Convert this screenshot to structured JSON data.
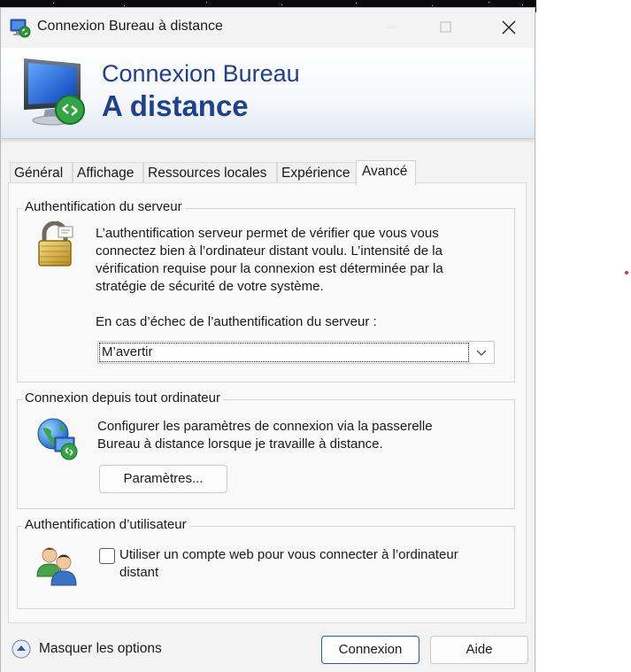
{
  "window": {
    "title": "Connexion Bureau à distance",
    "icons": [
      "remote-desktop-icon",
      "minimize-icon",
      "maximize-icon",
      "close-icon"
    ]
  },
  "banner": {
    "line1": "Connexion Bureau",
    "line2": "A distance",
    "icon": "remote-desktop-monitor-icon"
  },
  "tabs": [
    {
      "label": "Général"
    },
    {
      "label": "Affichage"
    },
    {
      "label": "Ressources locales"
    },
    {
      "label": "Expérience"
    },
    {
      "label": "Avancé",
      "active": true
    }
  ],
  "server_auth": {
    "legend": "Authentification du serveur",
    "description": "L’authentification serveur permet de vérifier que vous vous connectez bien à l’ordinateur distant voulu. L’intensité de la vérification requise pour la connexion est déterminée par la stratégie de sécurité de votre système.",
    "prompt": "En cas d’échec de l’authentification du serveur :",
    "selected": "M’avertir",
    "icon": "padlock-icon"
  },
  "connect_anywhere": {
    "legend": "Connexion depuis tout ordinateur",
    "description": "Configurer les paramètres de connexion via la passerelle Bureau à distance lorsque je travaille à distance.",
    "button": "Paramètres...",
    "icon": "globe-remote-icon"
  },
  "user_auth": {
    "legend": "Authentification d’utilisateur",
    "checkbox_label": "Utiliser un compte web pour vous connecter à l’ordinateur distant",
    "checked": false,
    "icon": "users-icon"
  },
  "footer": {
    "toggle_label": "Masquer les options",
    "connect_button": "Connexion",
    "help_button": "Aide"
  },
  "colors": {
    "accent": "#1f3f8f",
    "primary_button_border": "#1f5faa"
  }
}
